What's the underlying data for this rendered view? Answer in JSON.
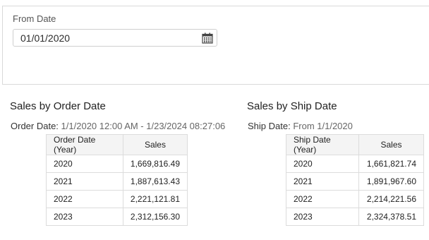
{
  "filter": {
    "from_label": "From Date",
    "from_value": "01/01/2020",
    "calendar_icon": "calendar-icon"
  },
  "order_section": {
    "title": "Sales by Order Date",
    "subtitle_label": "Order Date:",
    "subtitle_value": "1/1/2020 12:00 AM - 1/23/2024 08:27:06",
    "columns": [
      "Order Date (Year)",
      "Sales"
    ],
    "rows": [
      {
        "year": "2020",
        "sales": "1,669,816.49"
      },
      {
        "year": "2021",
        "sales": "1,887,613.43"
      },
      {
        "year": "2022",
        "sales": "2,221,121.81"
      },
      {
        "year": "2023",
        "sales": "2,312,156.30"
      }
    ]
  },
  "ship_section": {
    "title": "Sales by Ship Date",
    "subtitle_label": "Ship Date:",
    "subtitle_value": "From 1/1/2020",
    "columns": [
      "Ship Date (Year)",
      "Sales"
    ],
    "rows": [
      {
        "year": "2020",
        "sales": "1,661,821.74"
      },
      {
        "year": "2021",
        "sales": "1,891,967.60"
      },
      {
        "year": "2022",
        "sales": "2,214,221.56"
      },
      {
        "year": "2023",
        "sales": "2,324,378.51"
      }
    ]
  }
}
